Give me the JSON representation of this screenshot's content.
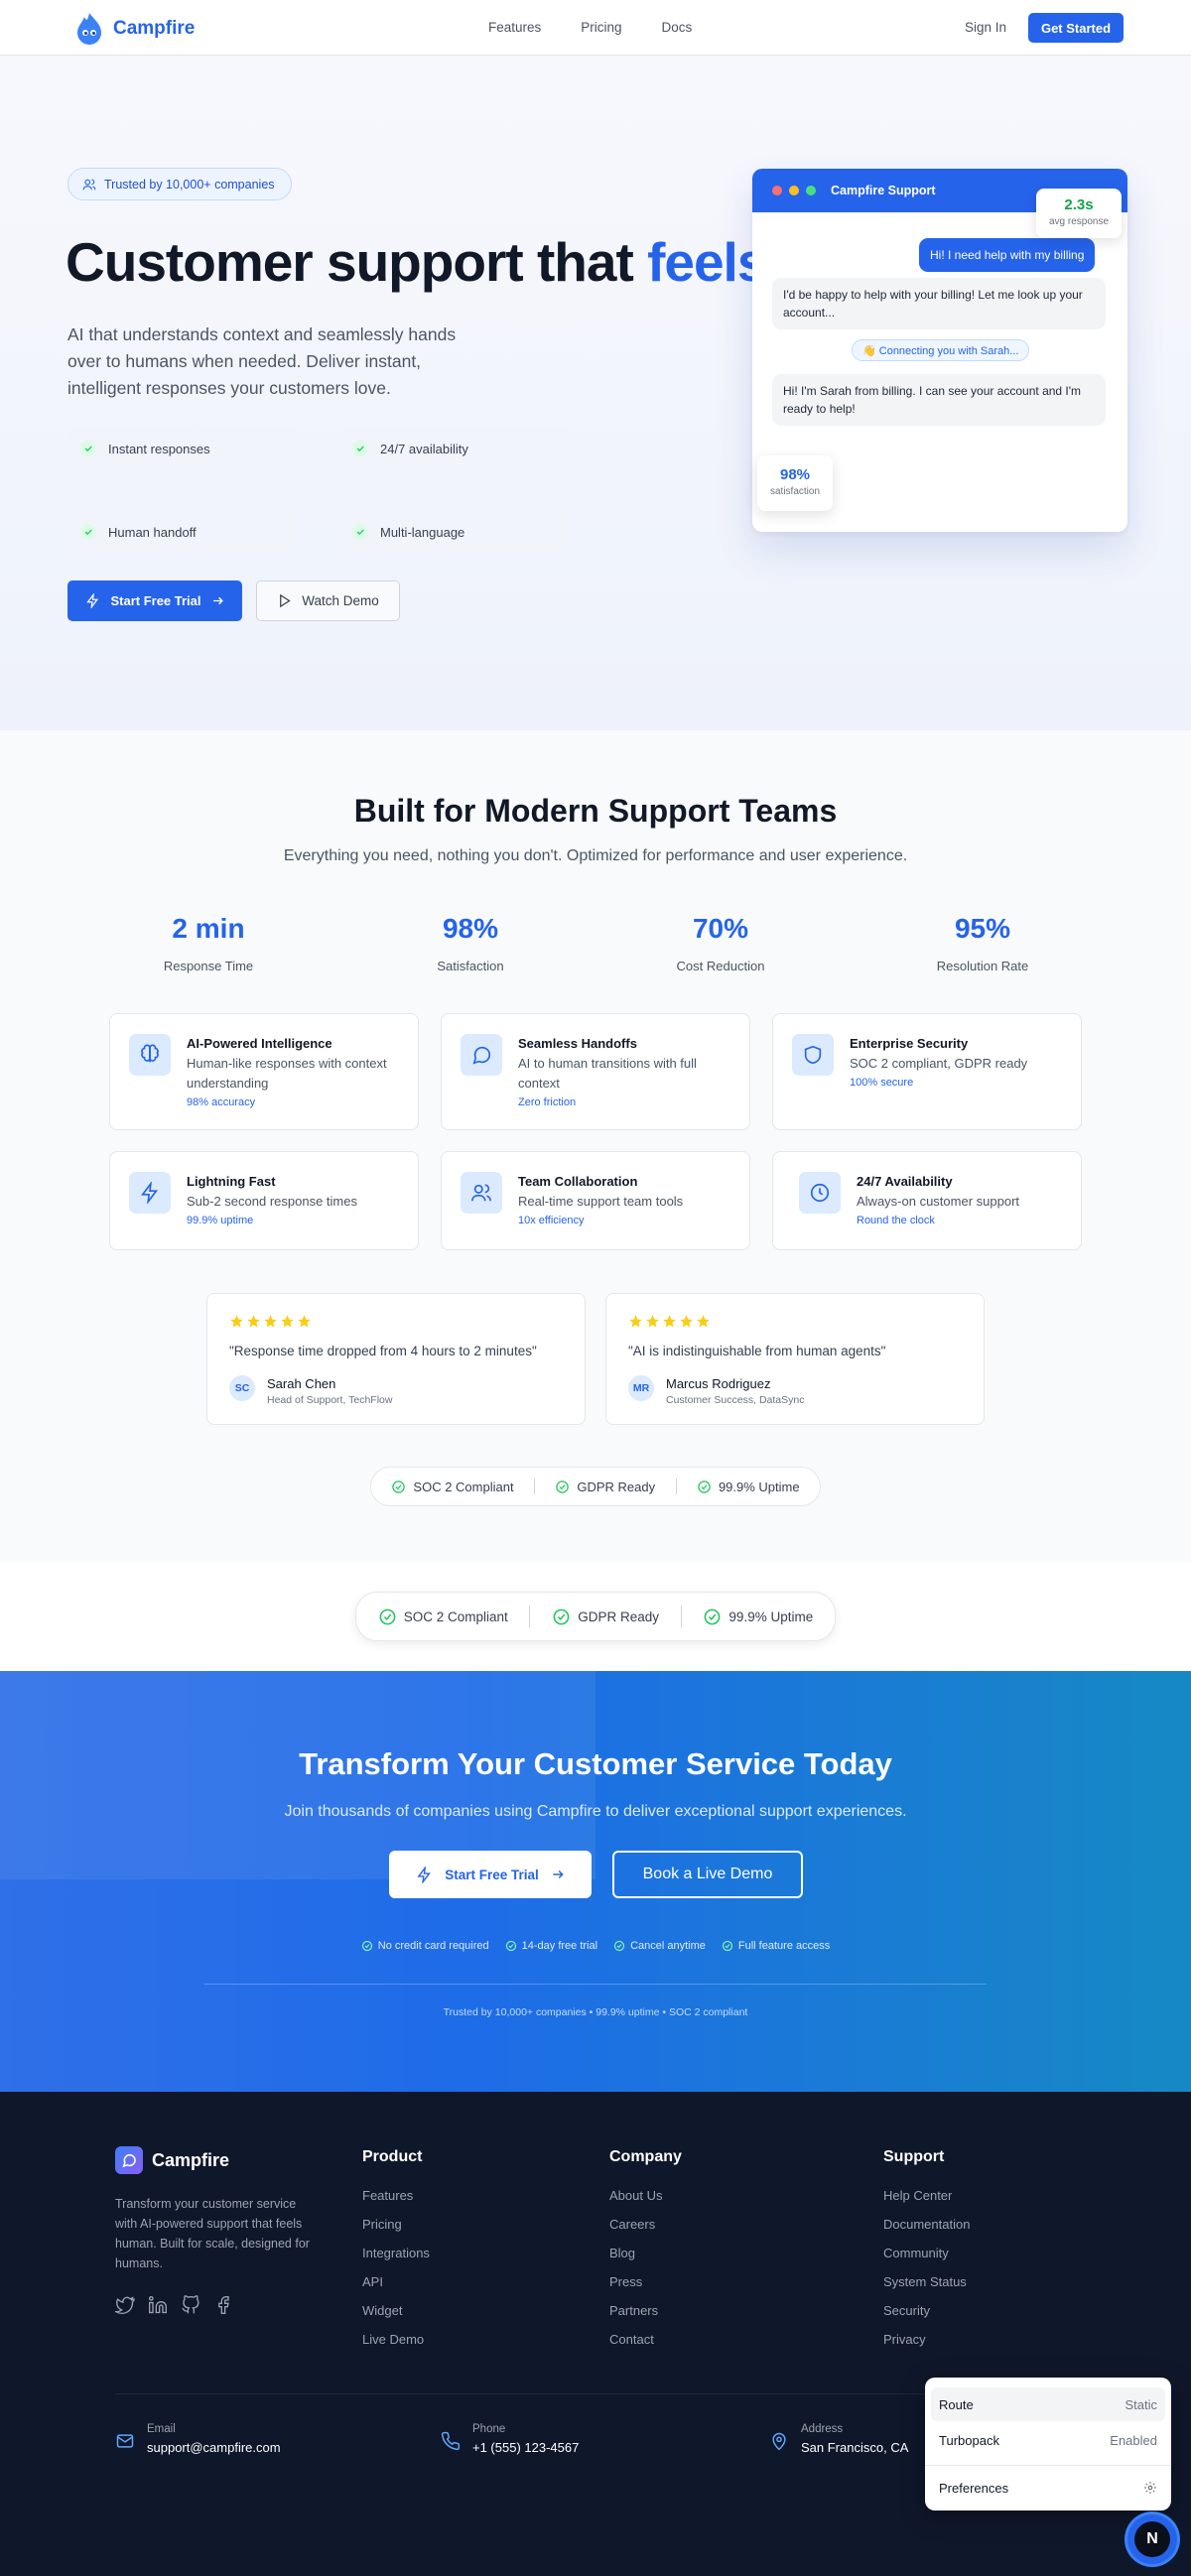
{
  "nav": {
    "brand": "Campfire",
    "links": [
      "Features",
      "Pricing",
      "Docs"
    ],
    "sign_in": "Sign In",
    "get_started": "Get Started"
  },
  "hero": {
    "badge": "Trusted by 10,000+ companies",
    "title_start": "Customer support that ",
    "title_accent": "feels",
    "lead": "AI that understands context and seamlessly hands over to humans when needed. Deliver instant, intelligent responses your customers love.",
    "features": [
      "Instant responses",
      "24/7 availability",
      "Human handoff",
      "Multi-language"
    ],
    "primary_cta": "Start Free Trial",
    "secondary_cta": "Watch Demo"
  },
  "chat": {
    "title": "Campfire Support",
    "messages": [
      {
        "from": "user",
        "text": "Hi! I need help with my billing"
      },
      {
        "from": "bot",
        "text": "I'd be happy to help with your billing! Let me look up your account..."
      },
      {
        "from": "bot",
        "text": "Hi! I'm Sarah from billing. I can see your account and I'm ready to help!"
      }
    ],
    "connecting": "👋 Connecting you with Sarah...",
    "avg_response_value": "2.3s",
    "avg_response_label": "avg response",
    "satisfaction_value": "98%",
    "satisfaction_label": "satisfaction"
  },
  "features_section": {
    "title": "Built for Modern Support Teams",
    "subtitle": "Everything you need, nothing you don't. Optimized for performance and user experience.",
    "metrics": [
      {
        "value": "2 min",
        "label": "Response Time"
      },
      {
        "value": "98%",
        "label": "Satisfaction"
      },
      {
        "value": "70%",
        "label": "Cost Reduction"
      },
      {
        "value": "95%",
        "label": "Resolution Rate"
      }
    ],
    "cards": [
      {
        "icon": "brain-icon",
        "title": "AI-Powered Intelligence",
        "desc": "Human-like responses with context understanding",
        "metric": "98% accuracy"
      },
      {
        "icon": "chat-bubble-icon",
        "title": "Seamless Handoffs",
        "desc": "AI to human transitions with full context",
        "metric": "Zero friction"
      },
      {
        "icon": "shield-icon",
        "title": "Enterprise Security",
        "desc": "SOC 2 compliant, GDPR ready",
        "metric": "100% secure"
      },
      {
        "icon": "lightning-icon",
        "title": "Lightning Fast",
        "desc": "Sub-2 second response times",
        "metric": "99.9% uptime"
      },
      {
        "icon": "users-icon",
        "title": "Team Collaboration",
        "desc": "Real-time support team tools",
        "metric": "10x efficiency"
      },
      {
        "icon": "clock-icon",
        "title": "24/7 Availability",
        "desc": "Always-on customer support",
        "metric": "Round the clock"
      }
    ],
    "testimonials": [
      {
        "stars": 5,
        "quote": "\"Response time dropped from 4 hours to 2 minutes\"",
        "initials": "SC",
        "name": "Sarah Chen",
        "role": "Head of Support, TechFlow"
      },
      {
        "stars": 5,
        "quote": "\"AI is indistinguishable from human agents\"",
        "initials": "MR",
        "name": "Marcus Rodriguez",
        "role": "Customer Success, DataSync"
      }
    ],
    "trust": [
      "SOC 2 Compliant",
      "GDPR Ready",
      "99.9% Uptime"
    ]
  },
  "band": {
    "trust": [
      "SOC 2 Compliant",
      "GDPR Ready",
      "99.9% Uptime"
    ]
  },
  "cta": {
    "title": "Transform Your Customer Service Today",
    "subtitle": "Join thousands of companies using Campfire to deliver exceptional support experiences.",
    "primary": "Start Free Trial",
    "secondary": "Book a Live Demo",
    "perks": [
      "No credit card required",
      "14-day free trial",
      "Cancel anytime",
      "Full feature access"
    ],
    "fine": "Trusted by 10,000+ companies • 99.9% uptime • SOC 2 compliant"
  },
  "footer": {
    "brand": "Campfire",
    "desc": "Transform your customer service with AI-powered support that feels human. Built for scale, designed for humans.",
    "columns": [
      {
        "title": "Product",
        "links": [
          "Features",
          "Pricing",
          "Integrations",
          "API",
          "Widget",
          "Live Demo"
        ]
      },
      {
        "title": "Company",
        "links": [
          "About Us",
          "Careers",
          "Blog",
          "Press",
          "Partners",
          "Contact"
        ]
      },
      {
        "title": "Support",
        "links": [
          "Help Center",
          "Documentation",
          "Community",
          "System Status",
          "Security",
          "Privacy"
        ]
      }
    ],
    "contact": [
      {
        "label": "Email",
        "value": "support@campfire.com"
      },
      {
        "label": "Phone",
        "value": "+1 (555) 123-4567"
      },
      {
        "label": "Address",
        "value": "San Francisco, CA"
      }
    ]
  },
  "dev_overlay": {
    "route_label": "Route",
    "route_value": "Static",
    "turbopack_label": "Turbopack",
    "turbopack_value": "Enabled",
    "preferences_label": "Preferences",
    "badge_letter": "N"
  },
  "colors": {
    "accent": "#2563eb",
    "success": "#22c55e",
    "footer_bg": "#0f172a",
    "star": "#facc15"
  }
}
